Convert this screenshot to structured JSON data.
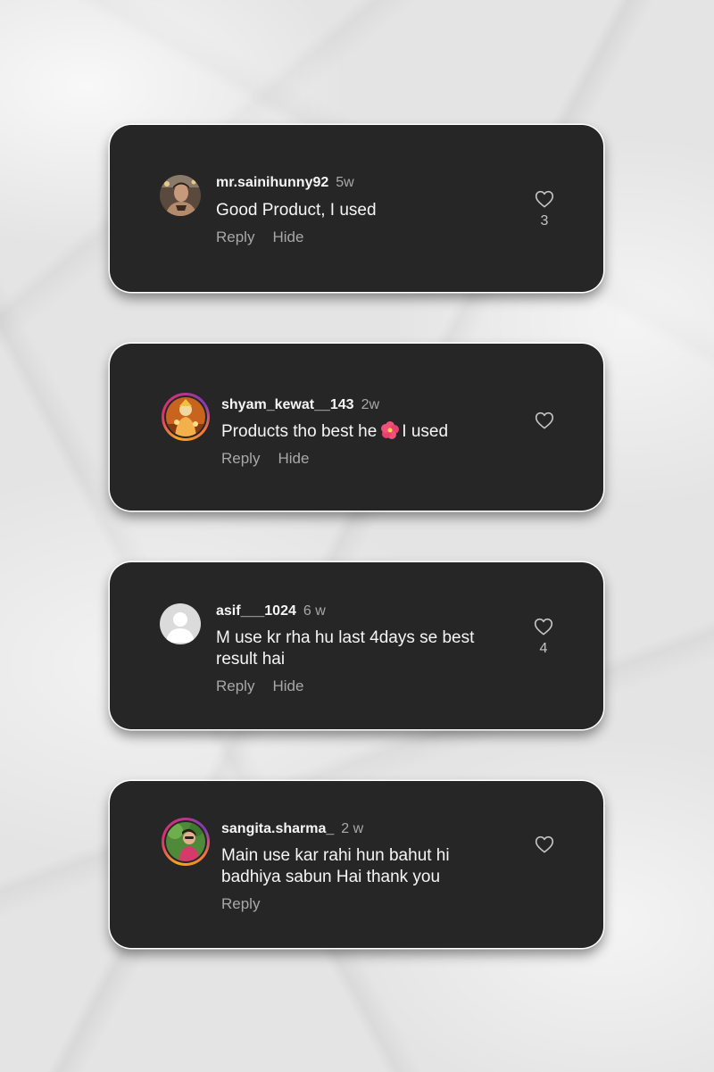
{
  "comments": [
    {
      "username": "mr.sainihunny92",
      "time": "5w",
      "text": "Good Product, I used",
      "reply_label": "Reply",
      "hide_label": "Hide",
      "likes": "3",
      "avatar": "profile-photo-man"
    },
    {
      "username": "shyam_kewat__143",
      "time": "2w",
      "text_before": "Products tho best he",
      "text_after": "I used",
      "emoji": "hibiscus-flower-emoji",
      "reply_label": "Reply",
      "hide_label": "Hide",
      "avatar": "profile-photo-deity-story-ring"
    },
    {
      "username": "asif___1024",
      "time": "6 w",
      "text_line1": "M use kr rha hu last 4days se best",
      "text_line2": "result hai",
      "reply_label": "Reply",
      "hide_label": "Hide",
      "likes": "4",
      "avatar": "default-avatar"
    },
    {
      "username": "sangita.sharma_",
      "time": "2 w",
      "text_line1": "Main use kar rahi hun bahut hi",
      "text_line2": "badhiya sabun Hai thank you",
      "reply_label": "Reply",
      "avatar": "profile-photo-woman-story-ring"
    }
  ],
  "colors": {
    "card_bg": "#262626",
    "text_primary": "#f5f5f5",
    "text_secondary": "#a8a8a8",
    "story_ring_start": "#f5a623",
    "story_ring_end": "#c13584"
  }
}
